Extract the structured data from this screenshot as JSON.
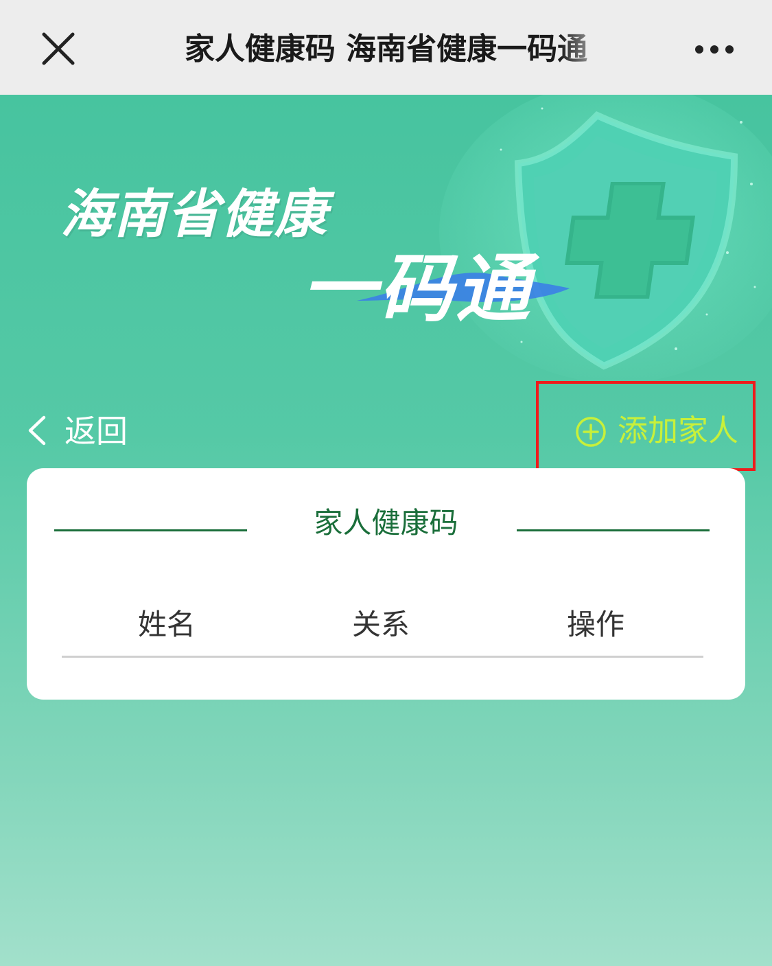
{
  "nav": {
    "title": "家人健康码 海南省健康一码通",
    "close_icon": "close-icon",
    "more_icon": "more-icon"
  },
  "banner": {
    "title": "海南省健康",
    "subtitle": "一码通",
    "decoration": "shield-cross-icon"
  },
  "actions": {
    "back_label": "返回",
    "add_label": "添加家人"
  },
  "card": {
    "title": "家人健康码",
    "columns": [
      "姓名",
      "关系",
      "操作"
    ]
  },
  "colors": {
    "nav_bg": "#ededed",
    "page_gradient_top": "#43c29d",
    "page_gradient_bottom": "#a2e0cb",
    "accent_green": "#1a6e3a",
    "add_label": "#c8f03a",
    "highlight_box": "#ee1c1c"
  }
}
